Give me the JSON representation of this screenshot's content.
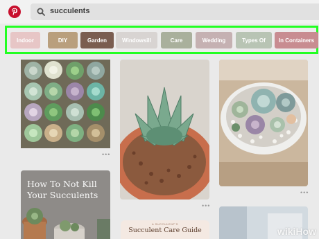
{
  "search": {
    "query": "succulents"
  },
  "chips": [
    {
      "label": "Indoor",
      "color": "#e7c6c6"
    },
    {
      "label": "DIY",
      "color": "#b99f7d"
    },
    {
      "label": "Garden",
      "color": "#7a5d50"
    },
    {
      "label": "Windowsill",
      "color": "#d8d4d2"
    },
    {
      "label": "Care",
      "color": "#a9b09c"
    },
    {
      "label": "Wedding",
      "color": "#c5b1b2"
    },
    {
      "label": "Types Of",
      "color": "#b8c4b4"
    },
    {
      "label": "In Containers",
      "color": "#c88c91"
    }
  ],
  "pins": {
    "kill_guide": {
      "title_lines": [
        "How To Not Kill",
        "Your Succulents"
      ]
    },
    "care_guide": {
      "small_text": "A SUCCULENT'S",
      "title": "Succulent Care Guide"
    }
  },
  "more_label": "•••",
  "watermark": {
    "wiki": "wiki",
    "how": "How"
  },
  "colors": {
    "pinterest": "#c8102e",
    "highlight": "#22ff22"
  }
}
